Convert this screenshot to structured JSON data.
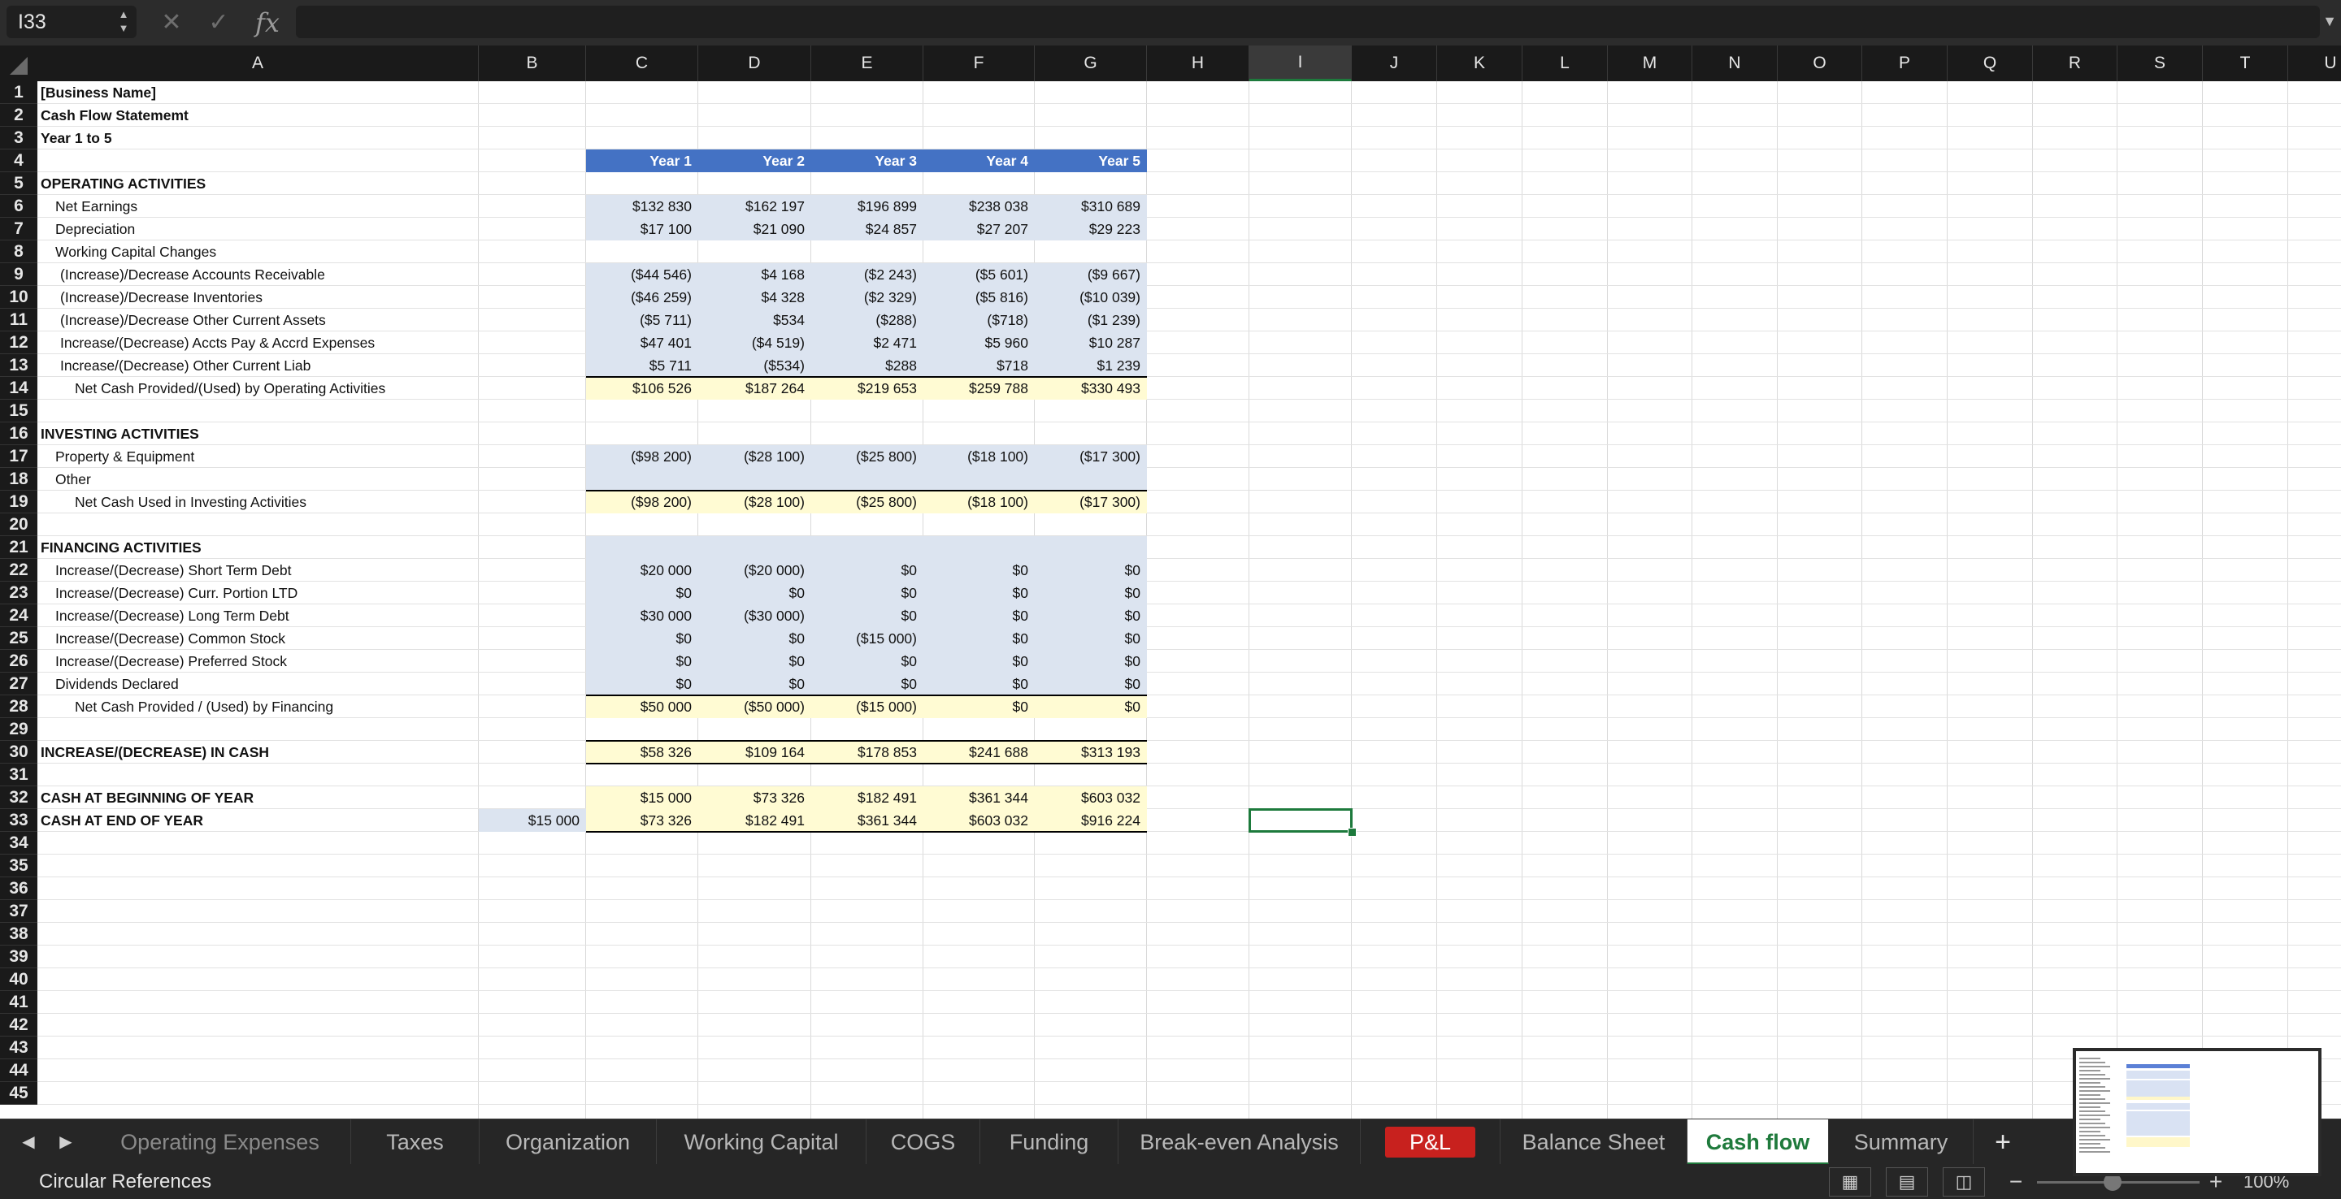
{
  "formula_bar": {
    "name_box": "I33",
    "formula": "",
    "fx_label": "fx"
  },
  "columns": [
    "A",
    "B",
    "C",
    "D",
    "E",
    "F",
    "G",
    "H",
    "I",
    "J",
    "K",
    "L",
    "M",
    "N",
    "O",
    "P",
    "Q",
    "R",
    "S",
    "T",
    "U"
  ],
  "selected_column": "I",
  "rows": [
    1,
    2,
    3,
    4,
    5,
    6,
    7,
    8,
    9,
    10,
    11,
    12,
    13,
    14,
    15,
    16,
    17,
    18,
    19,
    20,
    21,
    22,
    23,
    24,
    25,
    26,
    27,
    28,
    29,
    30,
    31,
    32,
    33,
    34,
    35,
    36,
    37,
    38,
    39,
    40,
    41,
    42,
    43,
    44,
    45
  ],
  "sheet": {
    "title": "[Business Name]",
    "subtitle": "Cash Flow Statememt",
    "period": "Year 1 to 5",
    "year_headers": [
      "Year 1",
      "Year 2",
      "Year 3",
      "Year 4",
      "Year 5"
    ],
    "lines": [
      {
        "row": 5,
        "label": "OPERATING ACTIVITIES",
        "indent": 0,
        "bold": true,
        "values": []
      },
      {
        "row": 6,
        "label": "Net Earnings",
        "indent": 1,
        "values": [
          "$132 830",
          "$162 197",
          "$196 899",
          "$238 038",
          "$310 689"
        ]
      },
      {
        "row": 7,
        "label": "Depreciation",
        "indent": 1,
        "values": [
          "$17 100",
          "$21 090",
          "$24 857",
          "$27 207",
          "$29 223"
        ]
      },
      {
        "row": 8,
        "label": "Working Capital Changes",
        "indent": 1,
        "values": []
      },
      {
        "row": 9,
        "label": "(Increase)/Decrease Accounts Receivable",
        "indent": 2,
        "values": [
          "($44 546)",
          "$4 168",
          "($2 243)",
          "($5 601)",
          "($9 667)"
        ]
      },
      {
        "row": 10,
        "label": "(Increase)/Decrease Inventories",
        "indent": 2,
        "values": [
          "($46 259)",
          "$4 328",
          "($2 329)",
          "($5 816)",
          "($10 039)"
        ]
      },
      {
        "row": 11,
        "label": "(Increase)/Decrease Other Current Assets",
        "indent": 2,
        "values": [
          "($5 711)",
          "$534",
          "($288)",
          "($718)",
          "($1 239)"
        ]
      },
      {
        "row": 12,
        "label": "Increase/(Decrease) Accts Pay & Accrd Expenses",
        "indent": 2,
        "values": [
          "$47 401",
          "($4 519)",
          "$2 471",
          "$5 960",
          "$10 287"
        ]
      },
      {
        "row": 13,
        "label": "Increase/(Decrease) Other Current Liab",
        "indent": 2,
        "values": [
          "$5 711",
          "($534)",
          "$288",
          "$718",
          "$1 239"
        ]
      },
      {
        "row": 14,
        "label": "Net Cash Provided/(Used) by Operating Activities",
        "indent": 3,
        "values": [
          "$106 526",
          "$187 264",
          "$219 653",
          "$259 788",
          "$330 493"
        ]
      },
      {
        "row": 16,
        "label": "INVESTING ACTIVITIES",
        "indent": 0,
        "bold": true,
        "values": []
      },
      {
        "row": 17,
        "label": "Property & Equipment",
        "indent": 1,
        "values": [
          "($98 200)",
          "($28 100)",
          "($25 800)",
          "($18 100)",
          "($17 300)"
        ]
      },
      {
        "row": 18,
        "label": "Other",
        "indent": 1,
        "values": []
      },
      {
        "row": 19,
        "label": "Net Cash Used in Investing Activities",
        "indent": 3,
        "values": [
          "($98 200)",
          "($28 100)",
          "($25 800)",
          "($18 100)",
          "($17 300)"
        ]
      },
      {
        "row": 21,
        "label": "FINANCING ACTIVITIES",
        "indent": 0,
        "bold": true,
        "values": []
      },
      {
        "row": 22,
        "label": "Increase/(Decrease) Short Term Debt",
        "indent": 1,
        "values": [
          "$20 000",
          "($20 000)",
          "$0",
          "$0",
          "$0"
        ]
      },
      {
        "row": 23,
        "label": "Increase/(Decrease) Curr. Portion LTD",
        "indent": 1,
        "values": [
          "$0",
          "$0",
          "$0",
          "$0",
          "$0"
        ]
      },
      {
        "row": 24,
        "label": "Increase/(Decrease) Long Term Debt",
        "indent": 1,
        "values": [
          "$30 000",
          "($30 000)",
          "$0",
          "$0",
          "$0"
        ]
      },
      {
        "row": 25,
        "label": "Increase/(Decrease) Common Stock",
        "indent": 1,
        "values": [
          "$0",
          "$0",
          "($15 000)",
          "$0",
          "$0"
        ]
      },
      {
        "row": 26,
        "label": "Increase/(Decrease) Preferred Stock",
        "indent": 1,
        "values": [
          "$0",
          "$0",
          "$0",
          "$0",
          "$0"
        ]
      },
      {
        "row": 27,
        "label": "Dividends Declared",
        "indent": 1,
        "values": [
          "$0",
          "$0",
          "$0",
          "$0",
          "$0"
        ]
      },
      {
        "row": 28,
        "label": "Net Cash Provided / (Used) by Financing",
        "indent": 3,
        "values": [
          "$50 000",
          "($50 000)",
          "($15 000)",
          "$0",
          "$0"
        ]
      },
      {
        "row": 30,
        "label": "INCREASE/(DECREASE) IN CASH",
        "indent": 0,
        "bold": true,
        "values": [
          "$58 326",
          "$109 164",
          "$178 853",
          "$241 688",
          "$313 193"
        ]
      },
      {
        "row": 32,
        "label": "CASH AT BEGINNING OF YEAR",
        "indent": 0,
        "bold": true,
        "values": [
          "$15 000",
          "$73 326",
          "$182 491",
          "$361 344",
          "$603 032"
        ]
      },
      {
        "row": 33,
        "label": "CASH AT END OF YEAR",
        "indent": 0,
        "bold": true,
        "values": [
          "$73 326",
          "$182 491",
          "$361 344",
          "$603 032",
          "$916 224"
        ]
      }
    ],
    "b33_value": "$15 000"
  },
  "tabs": [
    {
      "label": "Operating Expenses",
      "state": "partial"
    },
    {
      "label": "Taxes",
      "state": "normal"
    },
    {
      "label": "Organization",
      "state": "normal"
    },
    {
      "label": "Working Capital",
      "state": "normal"
    },
    {
      "label": "COGS",
      "state": "normal"
    },
    {
      "label": "Funding",
      "state": "normal"
    },
    {
      "label": "Break-even Analysis",
      "state": "normal"
    },
    {
      "label": "P&L",
      "state": "red"
    },
    {
      "label": "Balance Sheet",
      "state": "normal"
    },
    {
      "label": "Cash flow",
      "state": "active"
    },
    {
      "label": "Summary",
      "state": "normal"
    }
  ],
  "add_sheet_label": "+",
  "status": {
    "text": "Circular References",
    "zoom": "100%",
    "zoom_value": 100
  },
  "icons": {
    "stepper": "stepper-icon",
    "cancel": "cancel-icon",
    "enter": "check-icon",
    "fx": "function-icon",
    "expand": "chevron-down-icon",
    "prev": "chevron-left-icon",
    "next": "chevron-right-icon",
    "normal_view": "grid-view-icon",
    "page_layout": "page-layout-icon",
    "page_break": "page-break-icon"
  },
  "colors": {
    "header_blue": "#4472c4",
    "input_light_blue": "#dce4f0",
    "total_yellow": "#fffbd3",
    "active_green": "#1d7a3c",
    "pl_red": "#c8211e"
  }
}
